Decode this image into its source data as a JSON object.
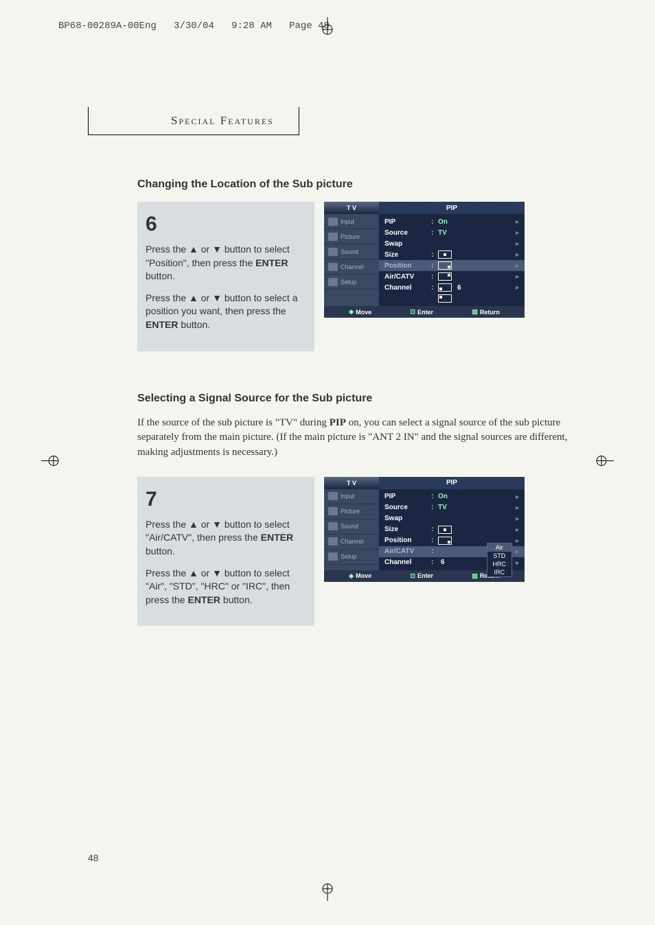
{
  "header": {
    "filename": "BP68-00289A-00Eng",
    "date": "3/30/04",
    "time": "9:28 AM",
    "page_label": "Page 48"
  },
  "section_header": "Special Features",
  "section1": {
    "title": "Changing the Location of the Sub picture",
    "step_number": "6",
    "para1_a": "Press the ▲ or ▼ button to select \"Position\", then press the ",
    "para1_b": "ENTER",
    "para1_c": " button.",
    "para2_a": "Press the ▲ or ▼ button to select a position you want, then press the ",
    "para2_b": "ENTER",
    "para2_c": " button."
  },
  "osd1": {
    "tv": "T V",
    "menu": "PIP",
    "sidebar": [
      "Input",
      "Picture",
      "Sound",
      "Channel",
      "Setup"
    ],
    "rows": {
      "pip": {
        "label": "PIP",
        "val": "On"
      },
      "source": {
        "label": "Source",
        "val": "TV"
      },
      "swap": {
        "label": "Swap"
      },
      "size": {
        "label": "Size"
      },
      "position": {
        "label": "Position"
      },
      "aircatv": {
        "label": "Air/CATV"
      },
      "channel": {
        "label": "Channel",
        "val": "6"
      }
    },
    "footer": {
      "move": "Move",
      "enter": "Enter",
      "return": "Return"
    }
  },
  "section2": {
    "title": "Selecting a Signal Source for the Sub picture",
    "desc_a": "If the source of the sub picture is \"TV\" during ",
    "desc_b": "PIP",
    "desc_c": " on, you can select a signal source of the sub picture separately from the main picture. (If the main picture is \"ANT 2 IN\" and the signal sources are different, making adjustments is necessary.)",
    "step_number": "7",
    "para1_a": "Press the ▲ or ▼ button to select \"Air/CATV\", then press the ",
    "para1_b": "ENTER",
    "para1_c": " button.",
    "para2_a": "Press the ▲ or ▼ button to select \"Air\", \"STD\", \"HRC\" or \"IRC\",  then press the ",
    "para2_b": "ENTER",
    "para2_c": " button."
  },
  "osd2": {
    "dropdown": [
      "Air",
      "STD",
      "HRC",
      "IRC"
    ]
  },
  "page_number": "48"
}
